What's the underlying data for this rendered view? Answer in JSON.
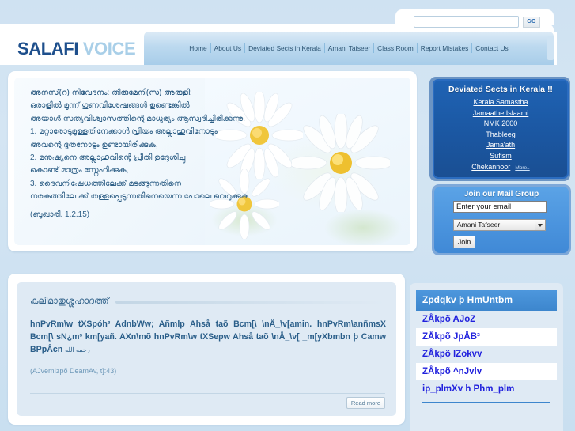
{
  "site": {
    "logo_primary": "SALAFI",
    "logo_secondary": "VOICE"
  },
  "search": {
    "value": "",
    "placeholder": "",
    "go_label": "GO"
  },
  "nav": {
    "items": [
      {
        "label": "Home"
      },
      {
        "label": "About Us"
      },
      {
        "label": "Deviated Sects in Kerala"
      },
      {
        "label": "Amani Tafseer"
      },
      {
        "label": "Class Room"
      },
      {
        "label": "Report Mistakes"
      },
      {
        "label": "Contact Us"
      }
    ]
  },
  "hero": {
    "lines": [
      "അനസ്(റ) നിവേദനം:",
      "തിരുമേനി(സ) അരുളി:",
      "ഒരാളില്‍ മൂന്ന് ഗുണവിശേഷങ്ങള്‍ ഉണ്ടെങ്കില്‍",
      "അയാള്‍ സത്യവിശ്വാസത്തിന്റെ മാധുര്യം ആസ്വദിച്ചിരിക്കുന്നു.",
      "1. മറ്റാരോടുമുള്ളതിനേക്കാള്‍ പ്രിയം അല്ലാഹുവിനോടും",
      "അവന്റെ ദൂതനോടും ഉണ്ടായിരിക്കുക,",
      "2. മനുഷ്യനെ അല്ലാഹുവിന്റെ പ്രീതി ഉദ്ദേശിച്ചു",
      "കൊണ്ട് മാത്രം സ്നേഹിക്കുക,",
      "3. ദൈവനിഷേധത്തിലേക്ക് മടങ്ങുന്നതിനെ",
      "നരകത്തിലേ ക്ക് തള്ളപ്പെടുന്നതിനെയെന്ന പോലെ വെറുക്കുക"
    ],
    "citation": "(ബുഖാരി. 1.2.15)"
  },
  "sects": {
    "title": "Deviated Sects in Kerala !!",
    "items": [
      {
        "label": "Kerala Samastha"
      },
      {
        "label": "Jamaathe Islaami"
      },
      {
        "label": "NMK 2000"
      },
      {
        "label": "Thableeg"
      },
      {
        "label": "Jama'ath"
      },
      {
        "label": "Sufism"
      },
      {
        "label": "Chekannoor"
      }
    ],
    "more_label": "More.."
  },
  "mail_group": {
    "title": "Join our Mail Group",
    "email_value": "Enter your email",
    "email_placeholder": "Enter your email",
    "selected_group": "Amani Tafseer",
    "join_label": "Join"
  },
  "article": {
    "heading": "കലിമാതുശ്ശഹാദത്ത്",
    "paragraph": "hnPvRm\\w tXSpóh³ AdnbWw; Añmlp Ahså taõ Bcm[\\ \\nÅ_\\v[amin. hnPvRm\\anñmsX Bcm[\\ sN¿m³ km[yañ. AXn\\mõ hnPvRm\\w tXSepw Ahså taõ \\nÅ_\\v[ _m[yXbmbn þ Camw BPpÅcn",
    "arabic": "رحمه الله",
    "citation": "(AJvemIzpõ DeamAv, t]:43)",
    "read_more_label": "Read more"
  },
  "sidelist": {
    "header": "Zpdqkv þ HmUntbm",
    "items": [
      {
        "label": "ZÅkpõ AJoZ"
      },
      {
        "label": "ZÅkpõ JpÅB³"
      },
      {
        "label": "ZÅkpõ lZokvv"
      },
      {
        "label": "ZÅkpõ ^nJvlv"
      },
      {
        "label": "ip_plmXv h Phm_plm"
      }
    ]
  },
  "colors": {
    "brand_dark": "#1e4f8c",
    "brand_light": "#a9cfe8",
    "sidebar_blue": "#1b57a2",
    "mail_blue": "#4a93dd",
    "link_blue": "#2020dd",
    "page_bg": "#cfe2f2"
  }
}
